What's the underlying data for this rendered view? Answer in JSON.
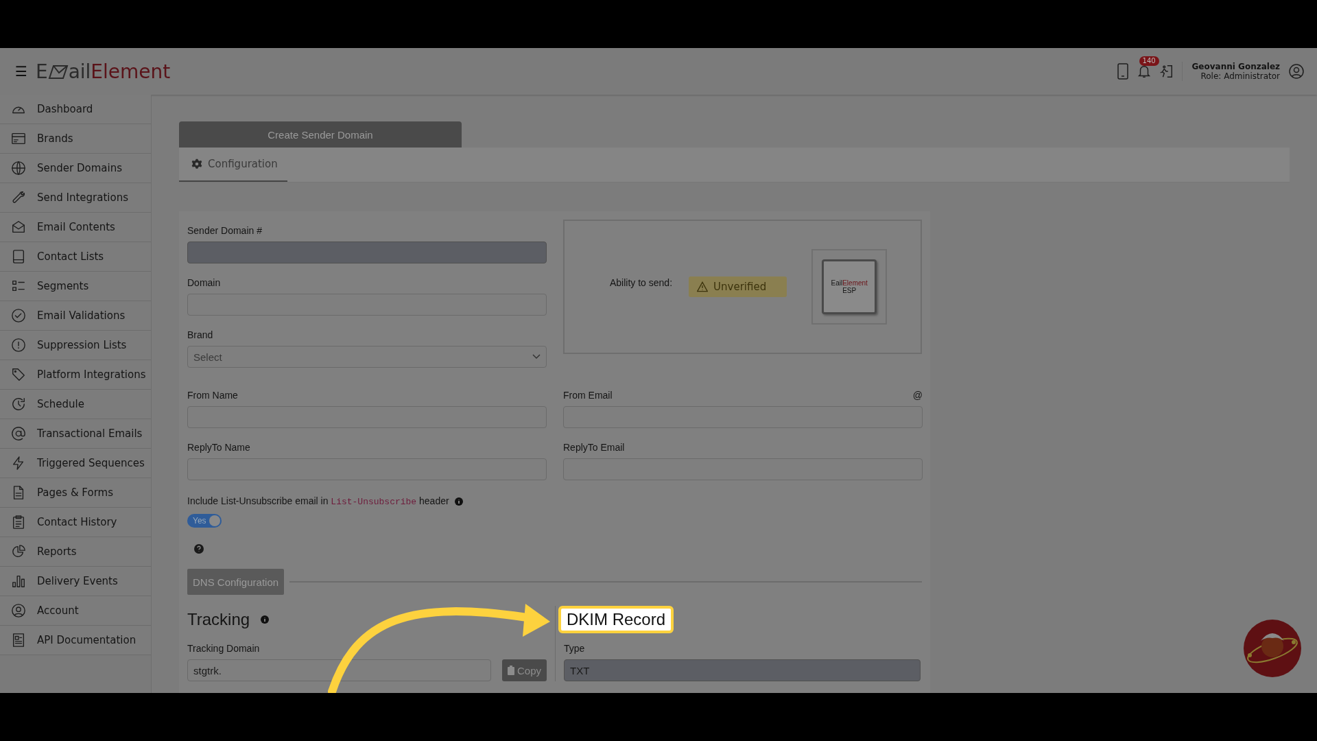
{
  "header": {
    "menu_icon": "☰",
    "logo": [
      "E",
      "ail",
      "Element"
    ],
    "notification_count": "140",
    "user_name": "Geovanni Gonzalez",
    "user_role": "Role: Administrator"
  },
  "sidebar": {
    "items": [
      {
        "label": "Dashboard"
      },
      {
        "label": "Brands"
      },
      {
        "label": "Sender Domains"
      },
      {
        "label": "Send Integrations"
      },
      {
        "label": "Email Contents"
      },
      {
        "label": "Contact Lists"
      },
      {
        "label": "Segments"
      },
      {
        "label": "Email Validations"
      },
      {
        "label": "Suppression Lists"
      },
      {
        "label": "Platform Integrations"
      },
      {
        "label": "Schedule"
      },
      {
        "label": "Transactional Emails"
      },
      {
        "label": "Triggered Sequences"
      },
      {
        "label": "Pages & Forms"
      },
      {
        "label": "Contact History"
      },
      {
        "label": "Reports"
      },
      {
        "label": "Delivery Events"
      },
      {
        "label": "Account"
      },
      {
        "label": "API Documentation"
      }
    ]
  },
  "page_title": "Create Sender Domain",
  "tabs": [
    {
      "label": "Configuration",
      "selected": true
    }
  ],
  "fields": [
    {
      "label": "Sender Domain #",
      "kind": "text",
      "disabled": true
    },
    {
      "label": "Domain",
      "kind": "text",
      "disabled": false
    },
    {
      "label": "Brand",
      "kind": "select",
      "disabled": false,
      "placeholder": "Select"
    }
  ],
  "status": {
    "label": "Ability to send:",
    "badge": "Unverified",
    "logo_word": [
      "E",
      "ail",
      "Element"
    ],
    "logo_sub": "ESP"
  },
  "contact_fields": [
    {
      "label": "From Name"
    },
    {
      "label": "From Email",
      "suffix": "@"
    },
    {
      "label": "ReplyTo Name"
    },
    {
      "label": "ReplyTo Email"
    }
  ],
  "unsubscribe": {
    "before": "Include List-Unsubscribe email in",
    "code": "List-Unsubscribe",
    "after": "header"
  },
  "toggle": {
    "label": "Yes",
    "on": true
  },
  "dns": {
    "button": "DNS Configuration",
    "tracking": {
      "title": "Tracking",
      "field_label": "Tracking Domain",
      "value": "stgtrk.",
      "copy": "Copy"
    },
    "dkim": {
      "title": "DKIM Record",
      "highlighted": true,
      "field_label": "Type",
      "value": "TXT"
    }
  }
}
